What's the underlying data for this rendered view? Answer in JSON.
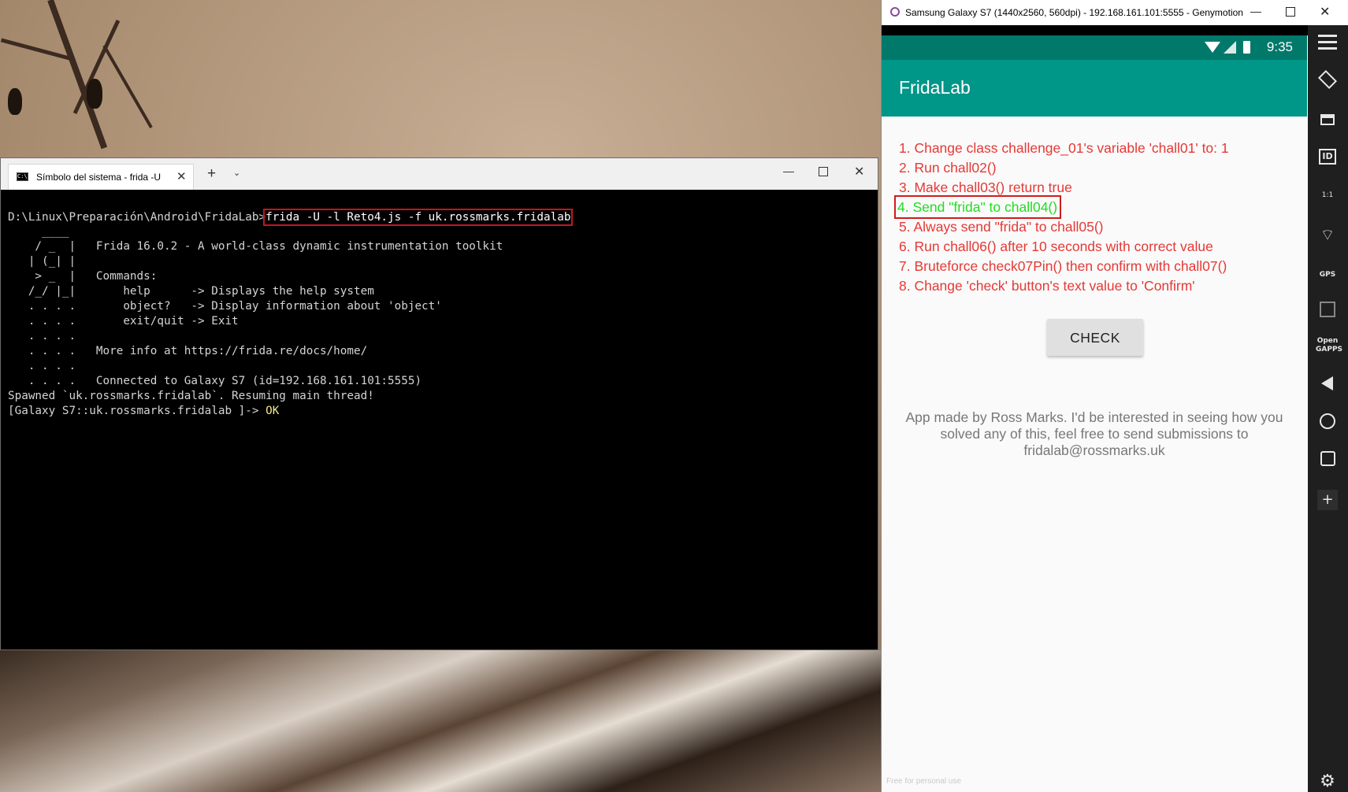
{
  "terminal": {
    "tab_title": "Símbolo del sistema - frida  -U",
    "tab_icon": "cmd-icon",
    "prompt": "D:\\Linux\\Preparación\\Android\\FridaLab>",
    "command": "frida -U -l Reto4.js -f uk.rossmarks.fridalab",
    "lines": [
      "     ____",
      "    / _  |   Frida 16.0.2 - A world-class dynamic instrumentation toolkit",
      "   | (_| |",
      "    > _  |   Commands:",
      "   /_/ |_|       help      -> Displays the help system",
      "   . . . .       object?   -> Display information about 'object'",
      "   . . . .       exit/quit -> Exit",
      "   . . . .",
      "   . . . .   More info at https://frida.re/docs/home/",
      "   . . . .",
      "   . . . .   Connected to Galaxy S7 (id=192.168.161.101:5555)",
      "Spawned `uk.rossmarks.fridalab`. Resuming main thread!"
    ],
    "repl_prompt": "[Galaxy S7::uk.rossmarks.fridalab ]-> ",
    "repl_output": "OK"
  },
  "genymotion": {
    "window_title": "Samsung Galaxy S7 (1440x2560, 560dpi) - 192.168.161.101:5555 - Genymotion",
    "status_time": "9:35",
    "app_title": "FridaLab",
    "challenges": [
      "1. Change class challenge_01's variable 'chall01' to: 1",
      "2. Run chall02()",
      "3. Make chall03() return true",
      "4. Send \"frida\" to chall04()",
      "5. Always send \"frida\" to chall05()",
      "6. Run chall06() after 10 seconds with correct value",
      "7. Bruteforce check07Pin() then confirm with chall07()",
      "8. Change 'check' button's text value to 'Confirm'"
    ],
    "completed_challenge": 4,
    "check_button": "CHECK",
    "credits": "App made by Ross Marks. I'd be interested in seeing how you solved any of this, feel free to send submissions to fridalab@rossmarks.uk",
    "watermark": "Free for personal use",
    "toolbar": {
      "id_label": "ID",
      "pixel_label": "1:1",
      "gps_label": "GPS",
      "opengapps_label": "Open GAPPS",
      "add_label": "+"
    }
  },
  "colors": {
    "app_bar": "#009688",
    "status_bar": "#00796b",
    "challenge_pending": "#e53935",
    "challenge_done": "#22dd22",
    "highlight_box": "#d01c1c"
  }
}
